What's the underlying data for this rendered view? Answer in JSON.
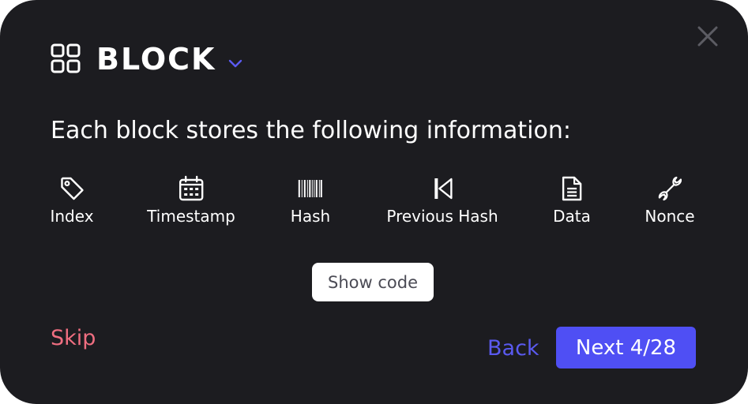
{
  "theme": {
    "background": "#1c1c20",
    "accent": "#4f4ff4",
    "back_color": "#5a5af0",
    "skip_color": "#ef6e80",
    "close_color": "#5c5c63"
  },
  "header": {
    "icon": "grid-icon",
    "title": "BLOCK",
    "dropdown_icon": "chevron-down-icon"
  },
  "intro": "Each block stores the following information:",
  "features": [
    {
      "label": "Index",
      "icon": "tag-icon"
    },
    {
      "label": "Timestamp",
      "icon": "calendar-icon"
    },
    {
      "label": "Hash",
      "icon": "barcode-icon"
    },
    {
      "label": "Previous Hash",
      "icon": "skip-back-icon"
    },
    {
      "label": "Data",
      "icon": "document-icon"
    },
    {
      "label": "Nonce",
      "icon": "wrench-icon"
    }
  ],
  "show_code_label": "Show code",
  "footer": {
    "skip_label": "Skip",
    "back_label": "Back",
    "next_label": "Next 4/28"
  }
}
